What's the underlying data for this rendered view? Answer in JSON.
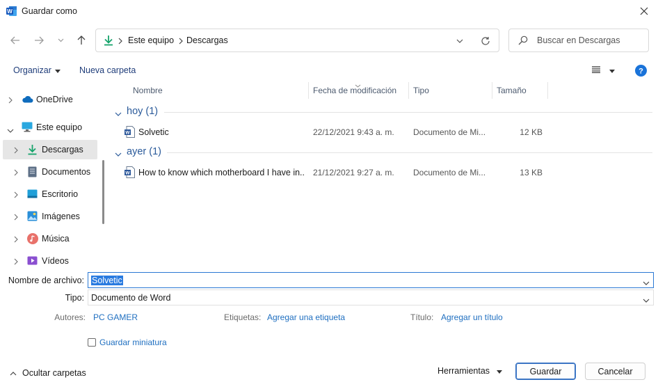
{
  "window": {
    "title": "Guardar como"
  },
  "nav": {
    "breadcrumb": [
      "Este equipo",
      "Descargas"
    ],
    "search_placeholder": "Buscar en Descargas"
  },
  "toolbar": {
    "organize": "Organizar",
    "new_folder": "Nueva carpeta"
  },
  "sidebar": {
    "items": [
      {
        "label": "OneDrive",
        "icon": "cloud-icon"
      },
      {
        "label": "Este equipo",
        "icon": "computer-icon"
      },
      {
        "label": "Descargas",
        "icon": "download-icon"
      },
      {
        "label": "Documentos",
        "icon": "documents-icon"
      },
      {
        "label": "Escritorio",
        "icon": "desktop-icon"
      },
      {
        "label": "Imágenes",
        "icon": "images-icon"
      },
      {
        "label": "Música",
        "icon": "music-icon"
      },
      {
        "label": "Vídeos",
        "icon": "videos-icon"
      }
    ]
  },
  "columns": {
    "name": "Nombre",
    "date": "Fecha de modificación",
    "type": "Tipo",
    "size": "Tamaño"
  },
  "groups": [
    {
      "label": "hoy (1)",
      "files": [
        {
          "name": "Solvetic",
          "date": "22/12/2021 9:43 a. m.",
          "type": "Documento de Mi...",
          "size": "12 KB"
        }
      ]
    },
    {
      "label": "ayer (1)",
      "files": [
        {
          "name": "How to know which motherboard I have in...",
          "date": "21/12/2021 9:27 a. m.",
          "type": "Documento de Mi...",
          "size": "13 KB"
        }
      ]
    }
  ],
  "form": {
    "filename_label": "Nombre de archivo:",
    "filename_value": "Solvetic",
    "type_label": "Tipo:",
    "type_value": "Documento de Word",
    "authors_label": "Autores:",
    "authors_value": "PC GAMER",
    "tags_label": "Etiquetas:",
    "tags_value": "Agregar una etiqueta",
    "title_label": "Título:",
    "title_value": "Agregar un título",
    "thumbnail_label": "Guardar miniatura"
  },
  "footer": {
    "hide_folders": "Ocultar carpetas",
    "tools": "Herramientas",
    "save": "Guardar",
    "cancel": "Cancelar"
  },
  "colors": {
    "word_blue": "#2b579a",
    "link_blue": "#1f6fc0",
    "download_green": "#16a36b",
    "help_blue": "#1a73d9"
  }
}
